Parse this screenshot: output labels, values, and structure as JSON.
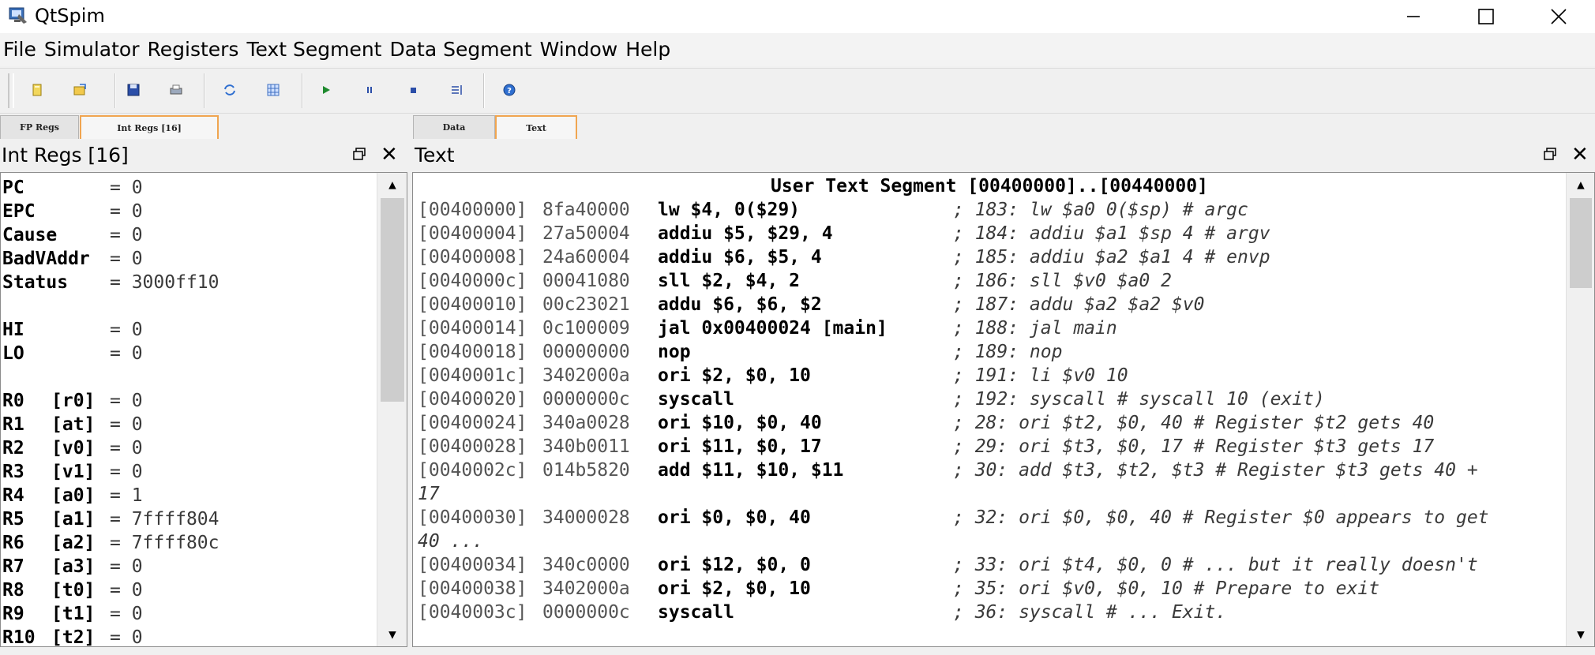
{
  "window": {
    "title": "QtSpim",
    "minimize": "—",
    "maximize": "☐",
    "close": "✕"
  },
  "menu": [
    "File",
    "Simulator",
    "Registers",
    "Text Segment",
    "Data Segment",
    "Window",
    "Help"
  ],
  "toolbar": {
    "buttons": [
      "open-icon",
      "reload-icon",
      "save-icon",
      "print-icon",
      "refresh-icon",
      "grid-icon",
      "run-icon",
      "pause-icon",
      "stop-icon",
      "step-icon",
      "help-icon"
    ]
  },
  "left_tabs": [
    "FP Regs",
    "Int Regs [16]"
  ],
  "right_tabs": [
    "Data",
    "Text"
  ],
  "left_pane": {
    "title": "Int Regs [16]",
    "float_icon": "float-window-icon",
    "close": "✕",
    "registers": [
      {
        "name": "PC",
        "alias": "",
        "value": "0"
      },
      {
        "name": "EPC",
        "alias": "",
        "value": "0"
      },
      {
        "name": "Cause",
        "alias": "",
        "value": "0"
      },
      {
        "name": "BadVAddr",
        "alias": "",
        "value": "0"
      },
      {
        "name": "Status",
        "alias": "",
        "value": "3000ff10"
      },
      {
        "name": "",
        "alias": "",
        "value": ""
      },
      {
        "name": "HI",
        "alias": "",
        "value": "0"
      },
      {
        "name": "LO",
        "alias": "",
        "value": "0"
      },
      {
        "name": "",
        "alias": "",
        "value": ""
      },
      {
        "name": "R0",
        "alias": "[r0]",
        "value": "0"
      },
      {
        "name": "R1",
        "alias": "[at]",
        "value": "0"
      },
      {
        "name": "R2",
        "alias": "[v0]",
        "value": "0"
      },
      {
        "name": "R3",
        "alias": "[v1]",
        "value": "0"
      },
      {
        "name": "R4",
        "alias": "[a0]",
        "value": "1"
      },
      {
        "name": "R5",
        "alias": "[a1]",
        "value": "7ffff804"
      },
      {
        "name": "R6",
        "alias": "[a2]",
        "value": "7ffff80c"
      },
      {
        "name": "R7",
        "alias": "[a3]",
        "value": "0"
      },
      {
        "name": "R8",
        "alias": "[t0]",
        "value": "0"
      },
      {
        "name": "R9",
        "alias": "[t1]",
        "value": "0"
      },
      {
        "name": "R10",
        "alias": "[t2]",
        "value": "0"
      }
    ]
  },
  "right_pane": {
    "title": "Text",
    "header": "User Text Segment [00400000]..[00440000]",
    "lines": [
      {
        "addr": "[00400000]",
        "code": "8fa40000",
        "instr": "lw $4, 0($29)",
        "comment": "; 183: lw $a0 0($sp) # argc"
      },
      {
        "addr": "[00400004]",
        "code": "27a50004",
        "instr": "addiu $5, $29, 4",
        "comment": "; 184: addiu $a1 $sp 4 # argv"
      },
      {
        "addr": "[00400008]",
        "code": "24a60004",
        "instr": "addiu $6, $5, 4",
        "comment": "; 185: addiu $a2 $a1 4 # envp"
      },
      {
        "addr": "[0040000c]",
        "code": "00041080",
        "instr": "sll $2, $4, 2",
        "comment": "; 186: sll $v0 $a0 2"
      },
      {
        "addr": "[00400010]",
        "code": "00c23021",
        "instr": "addu $6, $6, $2",
        "comment": "; 187: addu $a2 $a2 $v0"
      },
      {
        "addr": "[00400014]",
        "code": "0c100009",
        "instr": "jal 0x00400024 [main]",
        "comment": "; 188: jal main"
      },
      {
        "addr": "[00400018]",
        "code": "00000000",
        "instr": "nop",
        "comment": "; 189: nop"
      },
      {
        "addr": "[0040001c]",
        "code": "3402000a",
        "instr": "ori $2, $0, 10",
        "comment": "; 191: li $v0 10"
      },
      {
        "addr": "[00400020]",
        "code": "0000000c",
        "instr": "syscall",
        "comment": "; 192: syscall # syscall 10 (exit)"
      },
      {
        "addr": "[00400024]",
        "code": "340a0028",
        "instr": "ori $10, $0, 40",
        "comment": "; 28: ori $t2, $0, 40 # Register $t2 gets 40"
      },
      {
        "addr": "[00400028]",
        "code": "340b0011",
        "instr": "ori $11, $0, 17",
        "comment": "; 29: ori $t3, $0, 17 # Register $t3 gets 17"
      },
      {
        "addr": "[0040002c]",
        "code": "014b5820",
        "instr": "add $11, $10, $11",
        "comment": "; 30: add $t3, $t2, $t3 # Register $t3 gets 40 +",
        "wrap": "17"
      },
      {
        "addr": "[00400030]",
        "code": "34000028",
        "instr": "ori $0, $0, 40",
        "comment": "; 32: ori $0, $0, 40 # Register $0 appears to get",
        "wrap": "40 ..."
      },
      {
        "addr": "[00400034]",
        "code": "340c0000",
        "instr": "ori $12, $0, 0",
        "comment": "; 33: ori $t4, $0, 0 # ... but it really doesn't"
      },
      {
        "addr": "[00400038]",
        "code": "3402000a",
        "instr": "ori $2, $0, 10",
        "comment": "; 35: ori $v0, $0, 10 # Prepare to exit"
      },
      {
        "addr": "[0040003c]",
        "code": "0000000c",
        "instr": "syscall",
        "comment": "; 36: syscall # ... Exit."
      }
    ]
  },
  "scroll": {
    "up": "▲",
    "down": "▼"
  },
  "colors": {
    "active_tab_border": "#f0a550",
    "pane_bg": "#ffffff",
    "chrome_bg": "#f0f0f0"
  }
}
